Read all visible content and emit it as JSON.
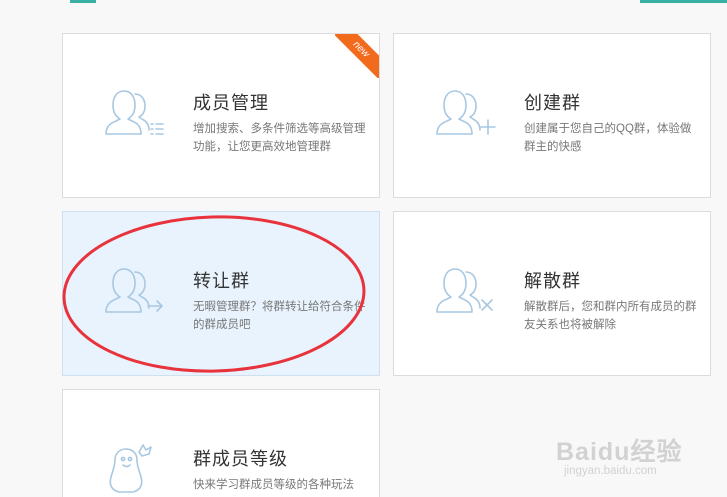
{
  "cards": [
    {
      "title": "成员管理",
      "desc": "增加搜索、多条件筛选等高级管理功能，让您更高效地管理群",
      "badge": "new"
    },
    {
      "title": "创建群",
      "desc": "创建属于您自己的QQ群，体验做群主的快感"
    },
    {
      "title": "转让群",
      "desc": "无暇管理群？将群转让给符合条件的群成员吧"
    },
    {
      "title": "解散群",
      "desc": "解散群后，您和群内所有成员的群友关系也将被解除"
    },
    {
      "title": "群成员等级",
      "desc": "快来学习群成员等级的各种玩法"
    }
  ],
  "watermark": {
    "brand": "Baidu经验",
    "url": "jingyan.baidu.com"
  },
  "colors": {
    "accent": "#3ab0a4",
    "badge": "#f26b1d",
    "highlight": "#e8333c",
    "icon_stroke": "#a8c8e2",
    "active_card": "#e8f3fd"
  }
}
